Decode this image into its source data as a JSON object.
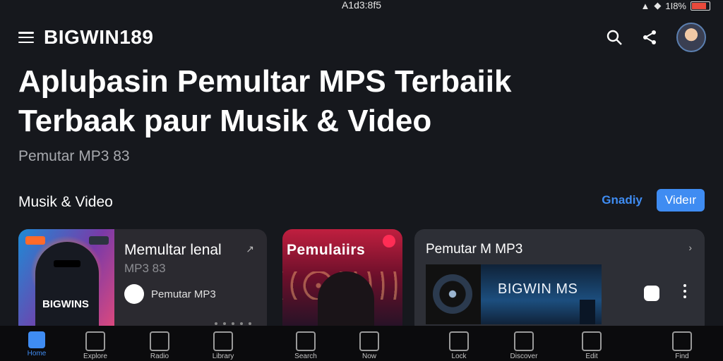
{
  "status_bar": {
    "time": "A1d3:8f5",
    "battery_text": "1I8%",
    "battery_level": 0.78
  },
  "app_bar": {
    "brand": "BIGWIN189"
  },
  "hero": {
    "headline_line1": "Apluþasin Pemultar MPS Terbaiik",
    "headline_line2": "Terbaak paur Musik & Video",
    "subtitle": "Pemutar MP3 83"
  },
  "section": {
    "title": "Musik & Video",
    "segment_inactive": "Gnadiy",
    "segment_active": "Videır"
  },
  "cards": {
    "card1": {
      "title": "Memultar lenal",
      "subtitle": "MP3 83",
      "artist": "Pemutar MP3",
      "thumb_text": "BIGWINS"
    },
    "card2": {
      "title": "Pemulaiirs"
    },
    "card3": {
      "title": "Pemutar M MP3",
      "art_text": "BIGWIN MS"
    }
  },
  "bottom_nav": [
    {
      "label": "Home",
      "icon": "home-icon",
      "active": true
    },
    {
      "label": "Explore",
      "icon": "people-icon"
    },
    {
      "label": "Radio",
      "icon": "radio-icon"
    },
    {
      "label": "Library",
      "icon": "list-icon"
    },
    {
      "label": "Search",
      "icon": "search-icon"
    },
    {
      "label": "Now",
      "icon": "play-icon"
    },
    {
      "label": "Lock",
      "icon": "lock-icon"
    },
    {
      "label": "Discover",
      "icon": "magnifier-icon"
    },
    {
      "label": "Edit",
      "icon": "edit-icon"
    },
    {
      "label": "Find",
      "icon": "search-icon"
    }
  ],
  "colors": {
    "accent": "#3f8cf2",
    "background": "#16181d"
  }
}
